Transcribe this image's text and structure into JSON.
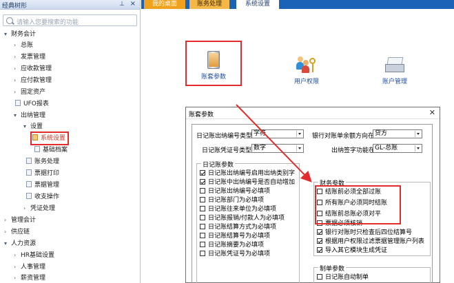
{
  "left_panel": {
    "title": "经典树形",
    "pin_icon": "pin-icon",
    "close_icon": "close-icon",
    "search_placeholder": "请输入您要搜索的功能",
    "tree": [
      {
        "label": "财务会计",
        "arrow": "▾",
        "level": 0
      },
      {
        "label": "总账",
        "arrow": "›",
        "level": 1
      },
      {
        "label": "发票管理",
        "arrow": "›",
        "level": 1
      },
      {
        "label": "应收款管理",
        "arrow": "›",
        "level": 1
      },
      {
        "label": "应付款管理",
        "arrow": "›",
        "level": 1
      },
      {
        "label": "固定资产",
        "arrow": "›",
        "level": 1
      },
      {
        "label": "UFO报表",
        "arrow": "",
        "level": 1
      },
      {
        "label": "出纳管理",
        "arrow": "▾",
        "level": 1
      },
      {
        "label": "设置",
        "arrow": "▾",
        "level": 2
      },
      {
        "label": "系统设置",
        "arrow": "",
        "level": 3
      },
      {
        "label": "基础档案",
        "arrow": "",
        "level": 3
      },
      {
        "label": "账务处理",
        "arrow": "",
        "level": 2
      },
      {
        "label": "票据打印",
        "arrow": "",
        "level": 2
      },
      {
        "label": "票据管理",
        "arrow": "",
        "level": 2
      },
      {
        "label": "收支操作",
        "arrow": "",
        "level": 2
      },
      {
        "label": "凭证处理",
        "arrow": "›",
        "level": 2
      },
      {
        "label": "管理会计",
        "arrow": "›",
        "level": 0
      },
      {
        "label": "供应链",
        "arrow": "›",
        "level": 0
      },
      {
        "label": "人力资源",
        "arrow": "▾",
        "level": 0
      },
      {
        "label": "HR基础设置",
        "arrow": "›",
        "level": 1
      },
      {
        "label": "人事管理",
        "arrow": "›",
        "level": 1
      },
      {
        "label": "薪资管理",
        "arrow": "›",
        "level": 1
      }
    ]
  },
  "tabs": [
    {
      "label": "我的桌面"
    },
    {
      "label": "账务处理"
    },
    {
      "label": "系统设置"
    }
  ],
  "functions": {
    "account_params": "账套参数",
    "user_permissions": "用户权限",
    "account_manage": "账户管理"
  },
  "dialog": {
    "title": "账套参数",
    "journal_no_type_label": "日记账出纳编号类型",
    "journal_no_type_value": "字符",
    "bank_balance_label": "银行对账单余额方向在",
    "bank_balance_value": "贷方",
    "voucher_no_type_label": "日记账凭证号类型",
    "voucher_no_type_value": "数字",
    "cashier_sign_label": "出纳签字功能在",
    "cashier_sign_value": "GL-总账",
    "journal_group": {
      "title": "日记账参数",
      "items": [
        {
          "label": "日记账出纳编号启用出纳类别字",
          "checked": true
        },
        {
          "label": "日记账中出纳编号是否自动增加",
          "checked": true
        },
        {
          "label": "日记账出纳编号必填项",
          "checked": false
        },
        {
          "label": "日记账部门为必填项",
          "checked": false
        },
        {
          "label": "日记账往来单位为必填项",
          "checked": false
        },
        {
          "label": "日记账报销/付款人为必填项",
          "checked": false
        },
        {
          "label": "日记账结算方式为必填项",
          "checked": false
        },
        {
          "label": "日记账结算号为必填项",
          "checked": false
        },
        {
          "label": "日记账摘要为必填项",
          "checked": false
        },
        {
          "label": "日记账凭证号为必填项",
          "checked": false
        }
      ]
    },
    "finance_group": {
      "title": "财务参数",
      "items": [
        {
          "label": "结账前必须全部过账",
          "checked": false
        },
        {
          "label": "所有账户必须同时结账",
          "checked": false
        },
        {
          "label": "结账前总账必须对平",
          "checked": false
        },
        {
          "label": "票据必须核销",
          "checked": false
        },
        {
          "label": "银行对账时只检查后四位结算号",
          "checked": true
        },
        {
          "label": "根据用户权限过滤票据管理账户列表",
          "checked": true
        },
        {
          "label": "导入其它模块生成凭证",
          "checked": true
        }
      ]
    },
    "voucher_group": {
      "title": "制单参数",
      "items": [
        {
          "label": "日记账自动制单",
          "checked": false
        }
      ]
    }
  },
  "colors": {
    "tab_bar": "#1b63b6",
    "tab_active": "#f0a11d",
    "highlight": "#e32b2b"
  }
}
